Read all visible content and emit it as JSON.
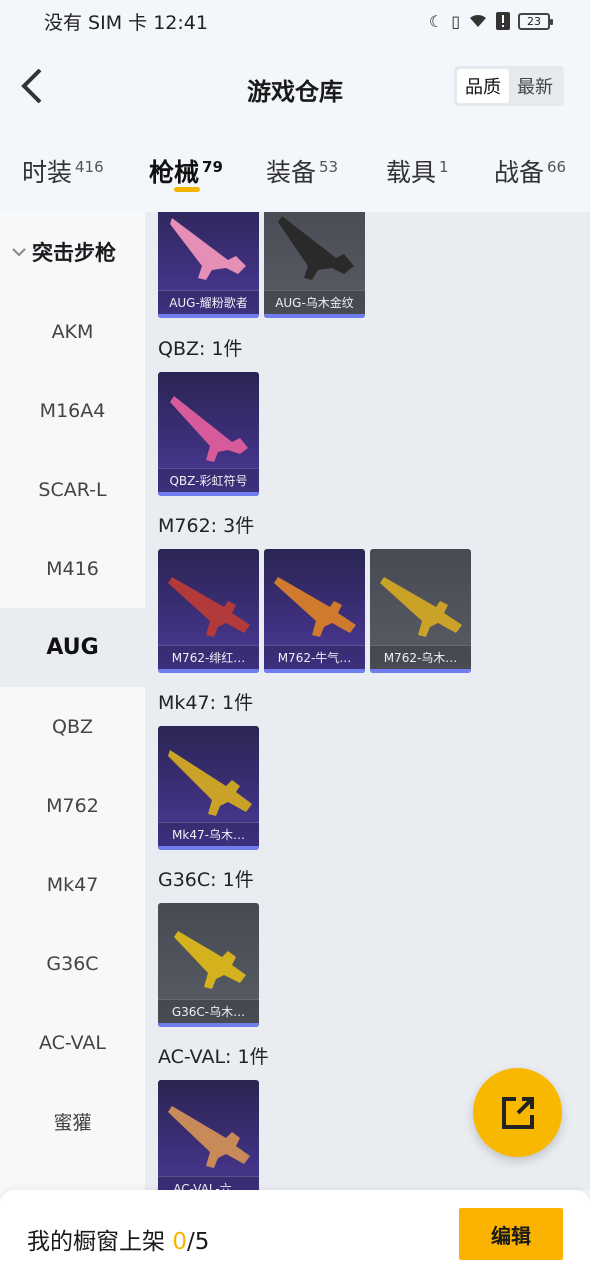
{
  "status_bar": {
    "carrier": "没有 SIM 卡",
    "time": "12:41",
    "battery": "23"
  },
  "header": {
    "title": "游戏仓库",
    "sort_options": [
      "品质",
      "最新"
    ],
    "sort_active": "品质"
  },
  "tabs": [
    {
      "label": "时装",
      "count": "416"
    },
    {
      "label": "枪械",
      "count": "79",
      "active": true
    },
    {
      "label": "装备",
      "count": "53"
    },
    {
      "label": "载具",
      "count": "1"
    },
    {
      "label": "战备",
      "count": "66"
    }
  ],
  "sidebar": {
    "group": "突击步枪",
    "items": [
      "AKM",
      "M16A4",
      "SCAR-L",
      "M416",
      "AUG",
      "QBZ",
      "M762",
      "Mk47",
      "G36C",
      "AC-VAL",
      "蜜獾",
      "…"
    ],
    "active": "AUG"
  },
  "sections": [
    {
      "title": "",
      "items": [
        {
          "label": "AUG-耀粉歌者",
          "rarity": "purple",
          "gun_color": "#e58fb6"
        },
        {
          "label": "AUG-乌木金纹",
          "rarity": "gray",
          "gun_color": "#2a2a2a"
        }
      ]
    },
    {
      "title": "QBZ: 1件",
      "items": [
        {
          "label": "QBZ-彩虹符号",
          "rarity": "purple",
          "gun_color": "#d75a9a"
        }
      ]
    },
    {
      "title": "M762: 3件",
      "items": [
        {
          "label": "M762-绯红…",
          "rarity": "purple",
          "gun_color": "#b33a3a"
        },
        {
          "label": "M762-牛气…",
          "rarity": "purple",
          "gun_color": "#d07a2e"
        },
        {
          "label": "M762-乌木…",
          "rarity": "gray",
          "gun_color": "#c9a227"
        }
      ]
    },
    {
      "title": "Mk47: 1件",
      "items": [
        {
          "label": "Mk47-乌木…",
          "rarity": "purple",
          "gun_color": "#c9a227"
        }
      ]
    },
    {
      "title": "G36C: 1件",
      "items": [
        {
          "label": "G36C-乌木…",
          "rarity": "gray",
          "gun_color": "#d4b21e"
        }
      ]
    },
    {
      "title": "AC-VAL: 1件",
      "items": [
        {
          "label": "AC-VAL-六…",
          "rarity": "purple",
          "gun_color": "#c98a5a"
        }
      ]
    }
  ],
  "bottom_bar": {
    "label": "我的橱窗上架",
    "count_current": "0",
    "count_total": "/5",
    "edit_button": "编辑"
  },
  "colors": {
    "accent": "#f9b300",
    "rarity_bar": "#6f7dee"
  }
}
